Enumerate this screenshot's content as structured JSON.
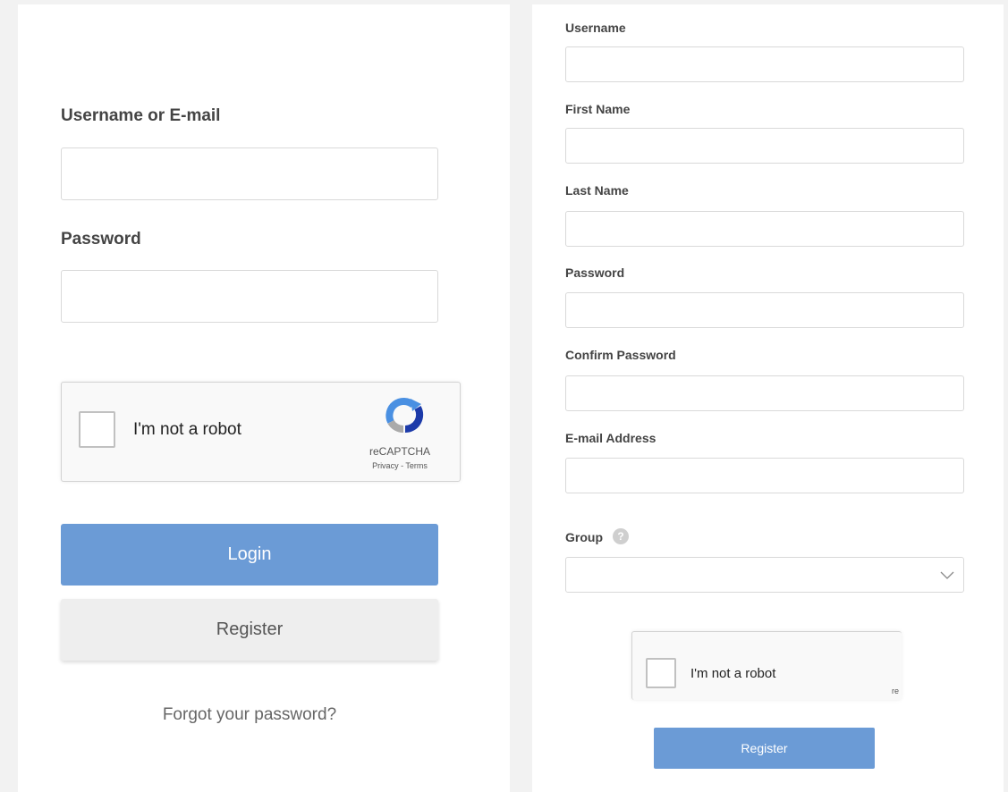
{
  "login": {
    "username_label": "Username or E-mail",
    "username_value": "",
    "password_label": "Password",
    "password_value": "",
    "captcha": {
      "label": "I'm not a robot",
      "brand": "reCAPTCHA",
      "privacy": "Privacy",
      "separator": " - ",
      "terms": "Terms"
    },
    "login_button": "Login",
    "register_button": "Register",
    "forgot_link": "Forgot your password?"
  },
  "register": {
    "fields": [
      {
        "label": "Username",
        "value": ""
      },
      {
        "label": "First Name",
        "value": ""
      },
      {
        "label": "Last Name",
        "value": ""
      },
      {
        "label": "Password",
        "value": ""
      },
      {
        "label": "Confirm Password",
        "value": ""
      },
      {
        "label": "E-mail Address",
        "value": ""
      }
    ],
    "group_label": "Group",
    "group_help": "?",
    "group_value": "",
    "captcha": {
      "label": "I'm not a robot",
      "brand_fragment": "re"
    },
    "register_button": "Register"
  },
  "colors": {
    "primary": "#6b9bd6",
    "secondary_button": "#eeeeee",
    "background": "#f2f2f2"
  }
}
